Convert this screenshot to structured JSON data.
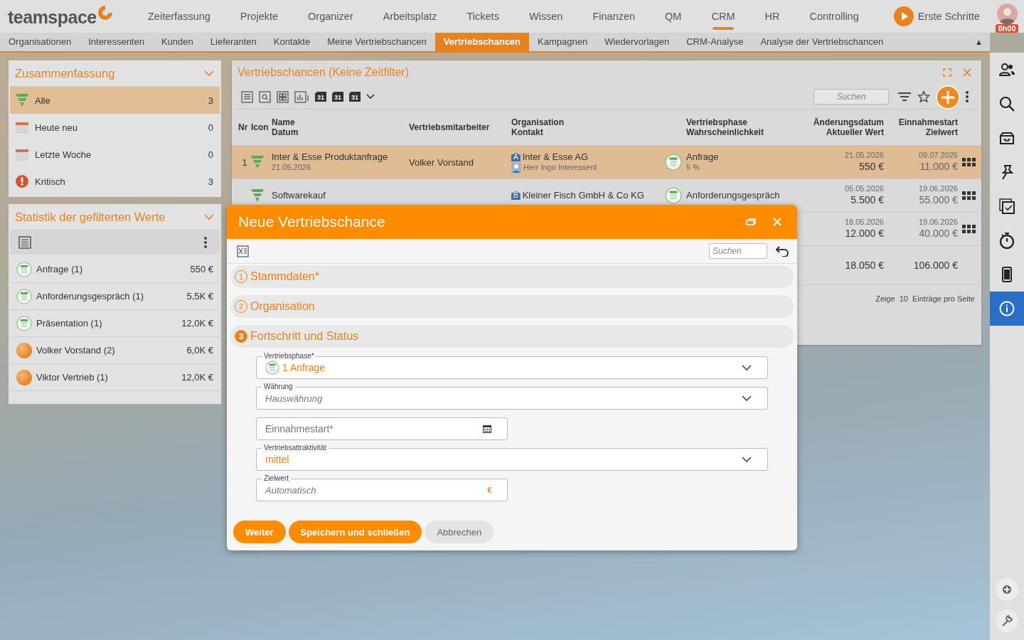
{
  "brand": {
    "name": "teamspace"
  },
  "main_nav": [
    {
      "label": "Zeiterfassung",
      "selected": false
    },
    {
      "label": "Projekte",
      "selected": false
    },
    {
      "label": "Organizer",
      "selected": false
    },
    {
      "label": "Arbeitsplatz",
      "selected": false
    },
    {
      "label": "Tickets",
      "selected": false
    },
    {
      "label": "Wissen",
      "selected": false
    },
    {
      "label": "Finanzen",
      "selected": false
    },
    {
      "label": "QM",
      "selected": false
    },
    {
      "label": "CRM",
      "selected": true
    },
    {
      "label": "HR",
      "selected": false
    },
    {
      "label": "Controlling",
      "selected": false
    }
  ],
  "getting_started": {
    "label": "Erste Schritte"
  },
  "user": {
    "time": "0h00"
  },
  "sub_nav": [
    {
      "label": "Organisationen",
      "selected": false
    },
    {
      "label": "Interessenten",
      "selected": false
    },
    {
      "label": "Kunden",
      "selected": false
    },
    {
      "label": "Lieferanten",
      "selected": false
    },
    {
      "label": "Kontakte",
      "selected": false
    },
    {
      "label": "Meine Vertriebschancen",
      "selected": false
    },
    {
      "label": "Vertriebschancen",
      "selected": true
    },
    {
      "label": "Kampagnen",
      "selected": false
    },
    {
      "label": "Wiedervorlagen",
      "selected": false
    },
    {
      "label": "CRM-Analyse",
      "selected": false
    },
    {
      "label": "Analyse der Vertriebschancen",
      "selected": false
    }
  ],
  "sub_nav_toggle": "▲",
  "summary": {
    "title": "Zusammenfassung",
    "items": [
      {
        "kind": "funnel",
        "label": "Alle",
        "count": "3",
        "selected": true
      },
      {
        "kind": "calendar",
        "label": "Heute neu",
        "count": "0",
        "selected": false
      },
      {
        "kind": "calendar",
        "label": "Letzte Woche",
        "count": "0",
        "selected": false
      },
      {
        "kind": "alert",
        "label": "Kritisch",
        "count": "3",
        "selected": false
      }
    ]
  },
  "statistics": {
    "title": "Statistik der gefilterten Werte",
    "items": [
      {
        "kind": "phase",
        "label": "Anfrage (1)",
        "value": "550 €"
      },
      {
        "kind": "phase",
        "label": "Anforderungsgespräch (1)",
        "value": "5,5K €"
      },
      {
        "kind": "phase",
        "label": "Präsentation (1)",
        "value": "12,0K €"
      },
      {
        "kind": "person",
        "label": "Volker Vorstand (2)",
        "value": "6,0K €"
      },
      {
        "kind": "person",
        "label": "Viktor Vertrieb (1)",
        "value": "12,0K €"
      }
    ]
  },
  "opportunities": {
    "title": "Vertriebschancen (Keine Zeitfilter)",
    "views": [
      {
        "kind": "list"
      },
      {
        "kind": "preview"
      },
      {
        "kind": "tiles"
      },
      {
        "kind": "chart"
      },
      {
        "kind": "calendar",
        "day": "31"
      },
      {
        "kind": "calendar",
        "day": "31"
      },
      {
        "kind": "calendar",
        "day": "31"
      }
    ],
    "search": {
      "placeholder": "Suchen"
    },
    "columns": [
      {
        "label": "Nr"
      },
      {
        "label": "Icon"
      },
      {
        "label": "Name",
        "sub": "Datum"
      },
      {
        "label": "Vertriebsmitarbeiter"
      },
      {
        "label": "Organisation",
        "sub": "Kontakt"
      },
      {
        "label": "Vertriebsphase",
        "sub": "Wahrscheinlichkeit"
      },
      {
        "label": "Änderungsdatum",
        "sub": "Aktueller Wert"
      },
      {
        "label": "Einnahmestart",
        "sub": "Zielwert"
      }
    ],
    "rows": [
      {
        "selected": true,
        "nr": "1",
        "name": "Inter & Esse Produktanfrage",
        "date": "21.05.2026",
        "sales_rep": "Volker Vorstand",
        "org_badge": "A",
        "organisation": "Inter & Esse AG",
        "contact": "Herr Ingo Interessent",
        "phase": "Anfrage",
        "probability": "5 %",
        "changed": "21.05.2026",
        "current_value": "550 €",
        "start": "09.07.2026",
        "target": "11.000 €"
      },
      {
        "selected": false,
        "name": "Softwarekauf",
        "org_badge": "B",
        "organisation": "Kleiner Fisch GmbH & Co KG",
        "phase": "Anforderungsgespräch",
        "changed": "05.05.2026",
        "current_value": "5.500 €",
        "start": "19.06.2026",
        "target": "55.000 €"
      },
      {
        "selected": false,
        "changed": "18.05.2026",
        "current_value": "12.000 €",
        "start": "19.06.2026",
        "target": "40.000 €"
      }
    ],
    "totals": {
      "current_value": "18.050 €",
      "target": "106.000 €"
    },
    "pagination": {
      "prefix": "Zeige",
      "page_size": "10",
      "suffix": "Einträge pro Seite"
    }
  },
  "tool_rail": [
    {
      "selected": false
    },
    {
      "selected": false
    },
    {
      "selected": false
    },
    {
      "selected": false
    },
    {
      "selected": false
    },
    {
      "selected": false
    },
    {
      "selected": false
    },
    {
      "selected": true
    }
  ],
  "dialog": {
    "title": "Neue Vertriebschance",
    "search": {
      "placeholder": "Suchen"
    },
    "sections": [
      {
        "number": "1",
        "title": "Stammdaten*",
        "expanded": false
      },
      {
        "number": "2",
        "title": "Organisation",
        "expanded": false
      },
      {
        "number": "3",
        "title": "Fortschritt und Status",
        "expanded": true
      }
    ],
    "fields": [
      {
        "kind": "select",
        "label": "Vertriebsphase*",
        "value": "1 Anfrage",
        "phase_icon": true
      },
      {
        "kind": "select",
        "label": "Währung",
        "placeholder": "Hauswährung"
      },
      {
        "kind": "date",
        "placeholder": "Einnahmestart*"
      },
      {
        "kind": "select",
        "label": "Vertriebsattraktivität",
        "value": "mittel"
      },
      {
        "kind": "currency",
        "label": "Zielwert",
        "placeholder": "Automatisch",
        "unit": "€"
      }
    ],
    "buttons": [
      {
        "kind": "primary",
        "label": "Weiter"
      },
      {
        "kind": "primary",
        "label": "Speichern und schließen"
      },
      {
        "kind": "secondary",
        "label": "Abbrechen"
      }
    ]
  }
}
